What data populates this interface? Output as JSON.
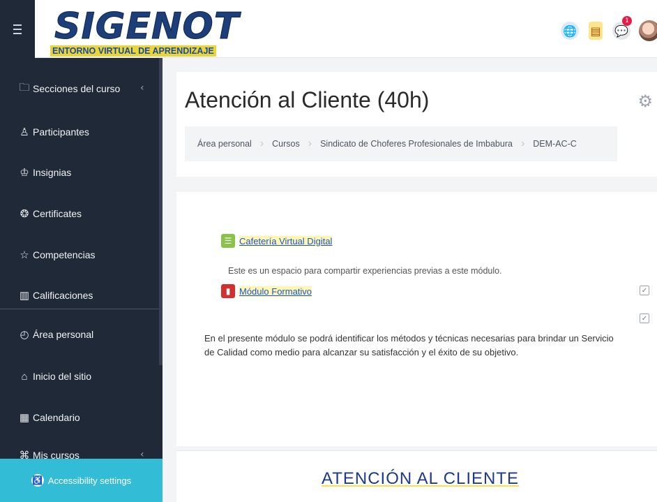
{
  "header": {
    "logo_title": "SIGENOT",
    "logo_subtitle": "ENTORNO VIRTUAL DE APRENDIZAJE",
    "notification_count": "1"
  },
  "sidebar": {
    "items": [
      {
        "label": "Secciones del curso",
        "icon": "folder-icon"
      },
      {
        "label": "Participantes",
        "icon": "users-icon"
      },
      {
        "label": "Insignias",
        "icon": "badge-icon"
      },
      {
        "label": "Certificates",
        "icon": "certificate-icon"
      },
      {
        "label": "Competencias",
        "icon": "star-icon"
      },
      {
        "label": "Calificaciones",
        "icon": "grades-icon"
      },
      {
        "label": "Área personal",
        "icon": "dashboard-icon"
      },
      {
        "label": "Inicio del sitio",
        "icon": "home-icon"
      },
      {
        "label": "Calendario",
        "icon": "calendar-icon"
      },
      {
        "label": "Mis cursos",
        "icon": "courses-icon"
      }
    ],
    "accessibility_label": "Accessibility settings"
  },
  "main": {
    "title": "Atención al Cliente (40h)",
    "breadcrumb": [
      "Área personal",
      "Cursos",
      "Sindicato de Choferes Profesionales de Imbabura",
      "DEM-AC-C"
    ],
    "activities": [
      {
        "label": "Cafetería Virtual Digital",
        "icon": "forum-icon"
      },
      {
        "label": "Módulo Formativo",
        "icon": "book-icon"
      }
    ],
    "forum_description": "Este es un espacio para compartir experiencias previas a este módulo.",
    "module_description": "En el presente módulo se podrá identificar los métodos y técnicas necesarias para brindar un Servicio de Calidad como medio para alcanzar su satisfacción y el éxito de su objetivo.",
    "banner_title": "ATENCIÓN AL CLIENTE"
  }
}
